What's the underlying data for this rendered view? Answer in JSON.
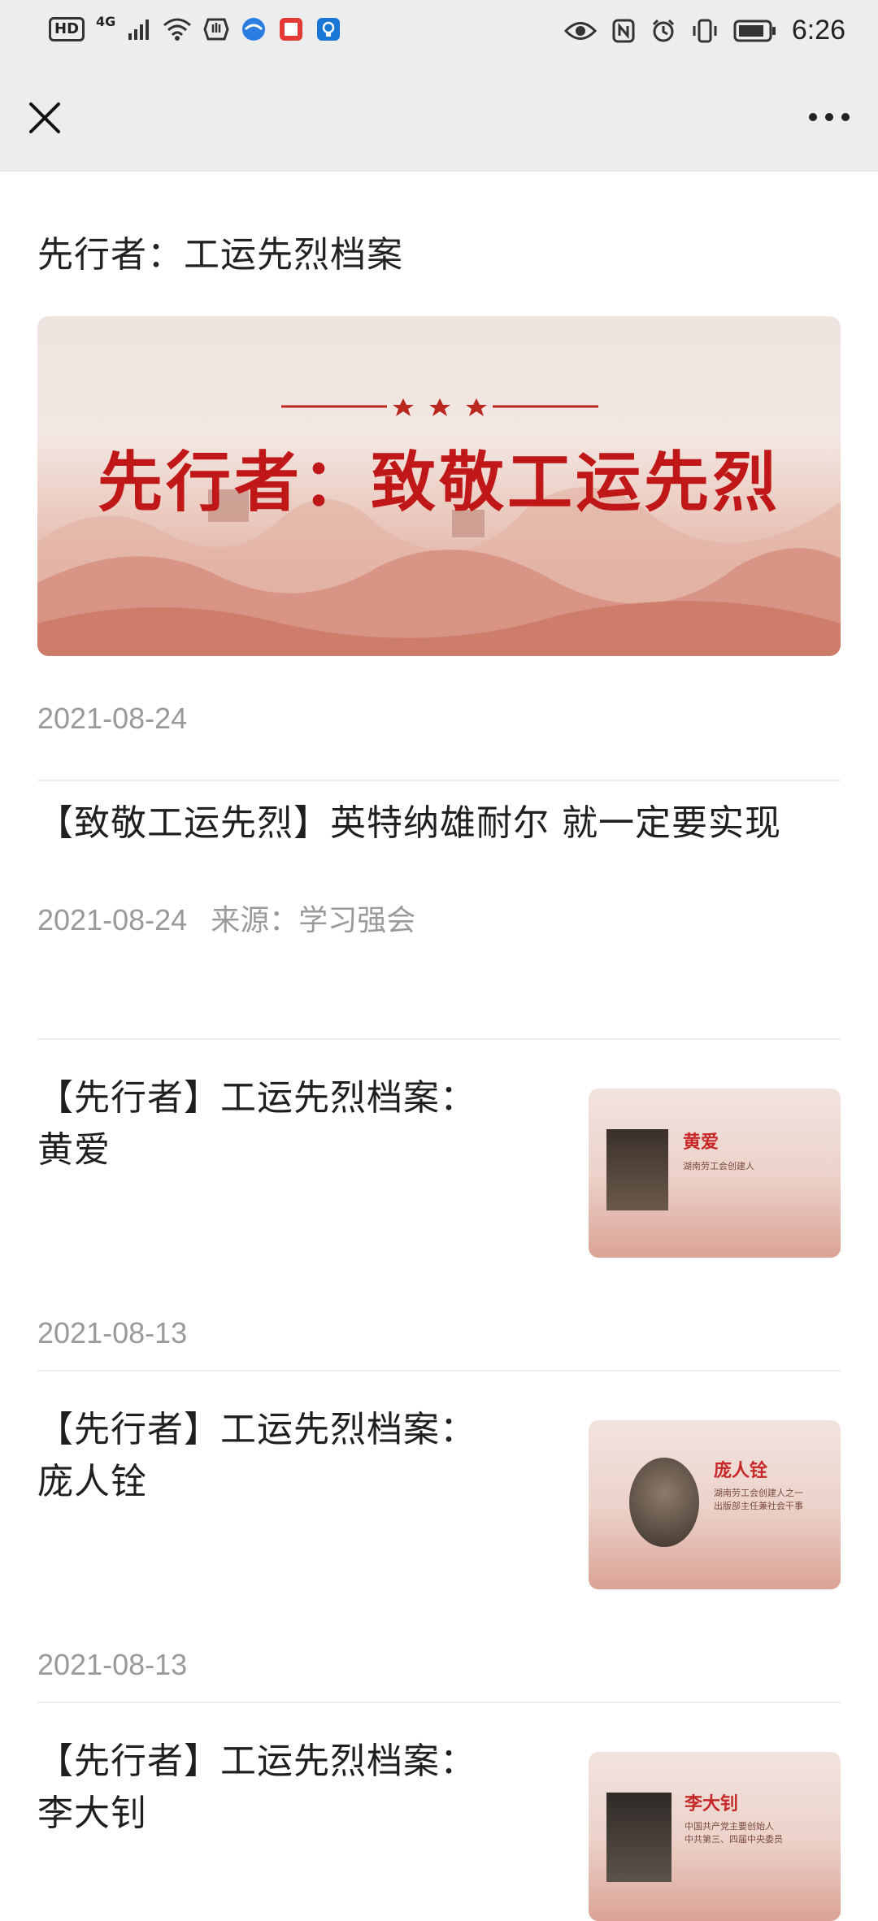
{
  "status_bar": {
    "left_labels": [
      "HD",
      "4G"
    ],
    "time": "6:26"
  },
  "nav": {
    "close_icon": "close-icon",
    "more_icon": "more-icon"
  },
  "page": {
    "title": "先行者：工运先烈档案",
    "banner": {
      "title": "先行者：致敬工运先烈",
      "date": "2021-08-24"
    }
  },
  "articles": [
    {
      "title": "【致敬工运先烈】英特纳雄耐尔 就一定要实现",
      "date": "2021-08-24",
      "source_label": "来源：",
      "source": "学习强会"
    },
    {
      "title_line1": "【先行者】工运先烈档案：",
      "title_line2": "黄爱",
      "date": "2021-08-13",
      "thumb": {
        "name": "黄爱",
        "caption": "湖南劳工会创建人"
      }
    },
    {
      "title_line1": "【先行者】工运先烈档案：",
      "title_line2": "庞人铨",
      "date": "2021-08-13",
      "thumb": {
        "name": "庞人铨",
        "caption": "湖南劳工会创建人之一\n出版部主任兼社会干事"
      }
    },
    {
      "title_line1": "【先行者】工运先烈档案：",
      "title_line2": "李大钊",
      "thumb": {
        "name": "李大钊",
        "caption": "中国共产党主要创始人\n中共第三、四届中央委员"
      }
    }
  ],
  "colors": {
    "status_bg": "#ededed",
    "banner_red": "#c01818",
    "date_gray": "#9a9a9a"
  }
}
